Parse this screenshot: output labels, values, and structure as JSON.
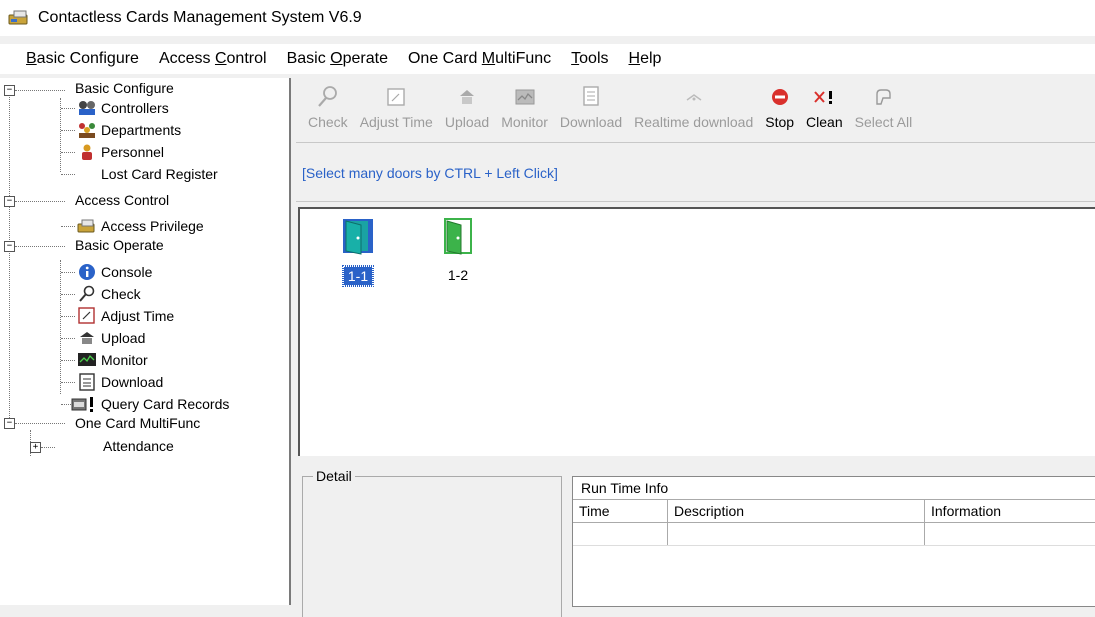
{
  "window": {
    "title": "Contactless Cards Management System  V6.9"
  },
  "menu": [
    {
      "pre": "",
      "u": "B",
      "post": "asic Configure"
    },
    {
      "pre": "Access ",
      "u": "C",
      "post": "ontrol"
    },
    {
      "pre": "Basic ",
      "u": "O",
      "post": "perate"
    },
    {
      "pre": "One Card ",
      "u": "M",
      "post": "ultiFunc"
    },
    {
      "pre": "",
      "u": "T",
      "post": "ools"
    },
    {
      "pre": "",
      "u": "H",
      "post": "elp"
    }
  ],
  "tree": {
    "basic_configure": "Basic Configure",
    "controllers": "Controllers",
    "departments": "Departments",
    "personnel": "Personnel",
    "lost_card": "Lost Card Register",
    "access_control": "Access Control",
    "access_privilege": "Access Privilege",
    "basic_operate": "Basic Operate",
    "console": "Console",
    "check": "Check",
    "adjust_time": "Adjust Time",
    "upload": "Upload",
    "monitor": "Monitor",
    "download": "Download",
    "query": "Query Card Records",
    "one_card": "One Card MultiFunc",
    "attendance": "Attendance"
  },
  "toolbar": {
    "check": "Check",
    "adjust_time": "Adjust Time",
    "upload": "Upload",
    "monitor": "Monitor",
    "download": "Download",
    "realtime_download": "Realtime download",
    "stop": "Stop",
    "clean": "Clean",
    "select_all": "Select All"
  },
  "hint": "[Select many doors by CTRL + Left Click]",
  "doors": [
    {
      "label": "1-1",
      "selected": true
    },
    {
      "label": "1-2",
      "selected": false
    }
  ],
  "detail": {
    "legend": "Detail"
  },
  "runtime": {
    "caption": "Run Time Info",
    "columns": [
      "Time",
      "Description",
      "Information"
    ]
  },
  "colors": {
    "accent": "#2a62c8",
    "stop_red": "#d9302c",
    "door_teal": "#1aa3a3",
    "door_green": "#3cb34a"
  }
}
